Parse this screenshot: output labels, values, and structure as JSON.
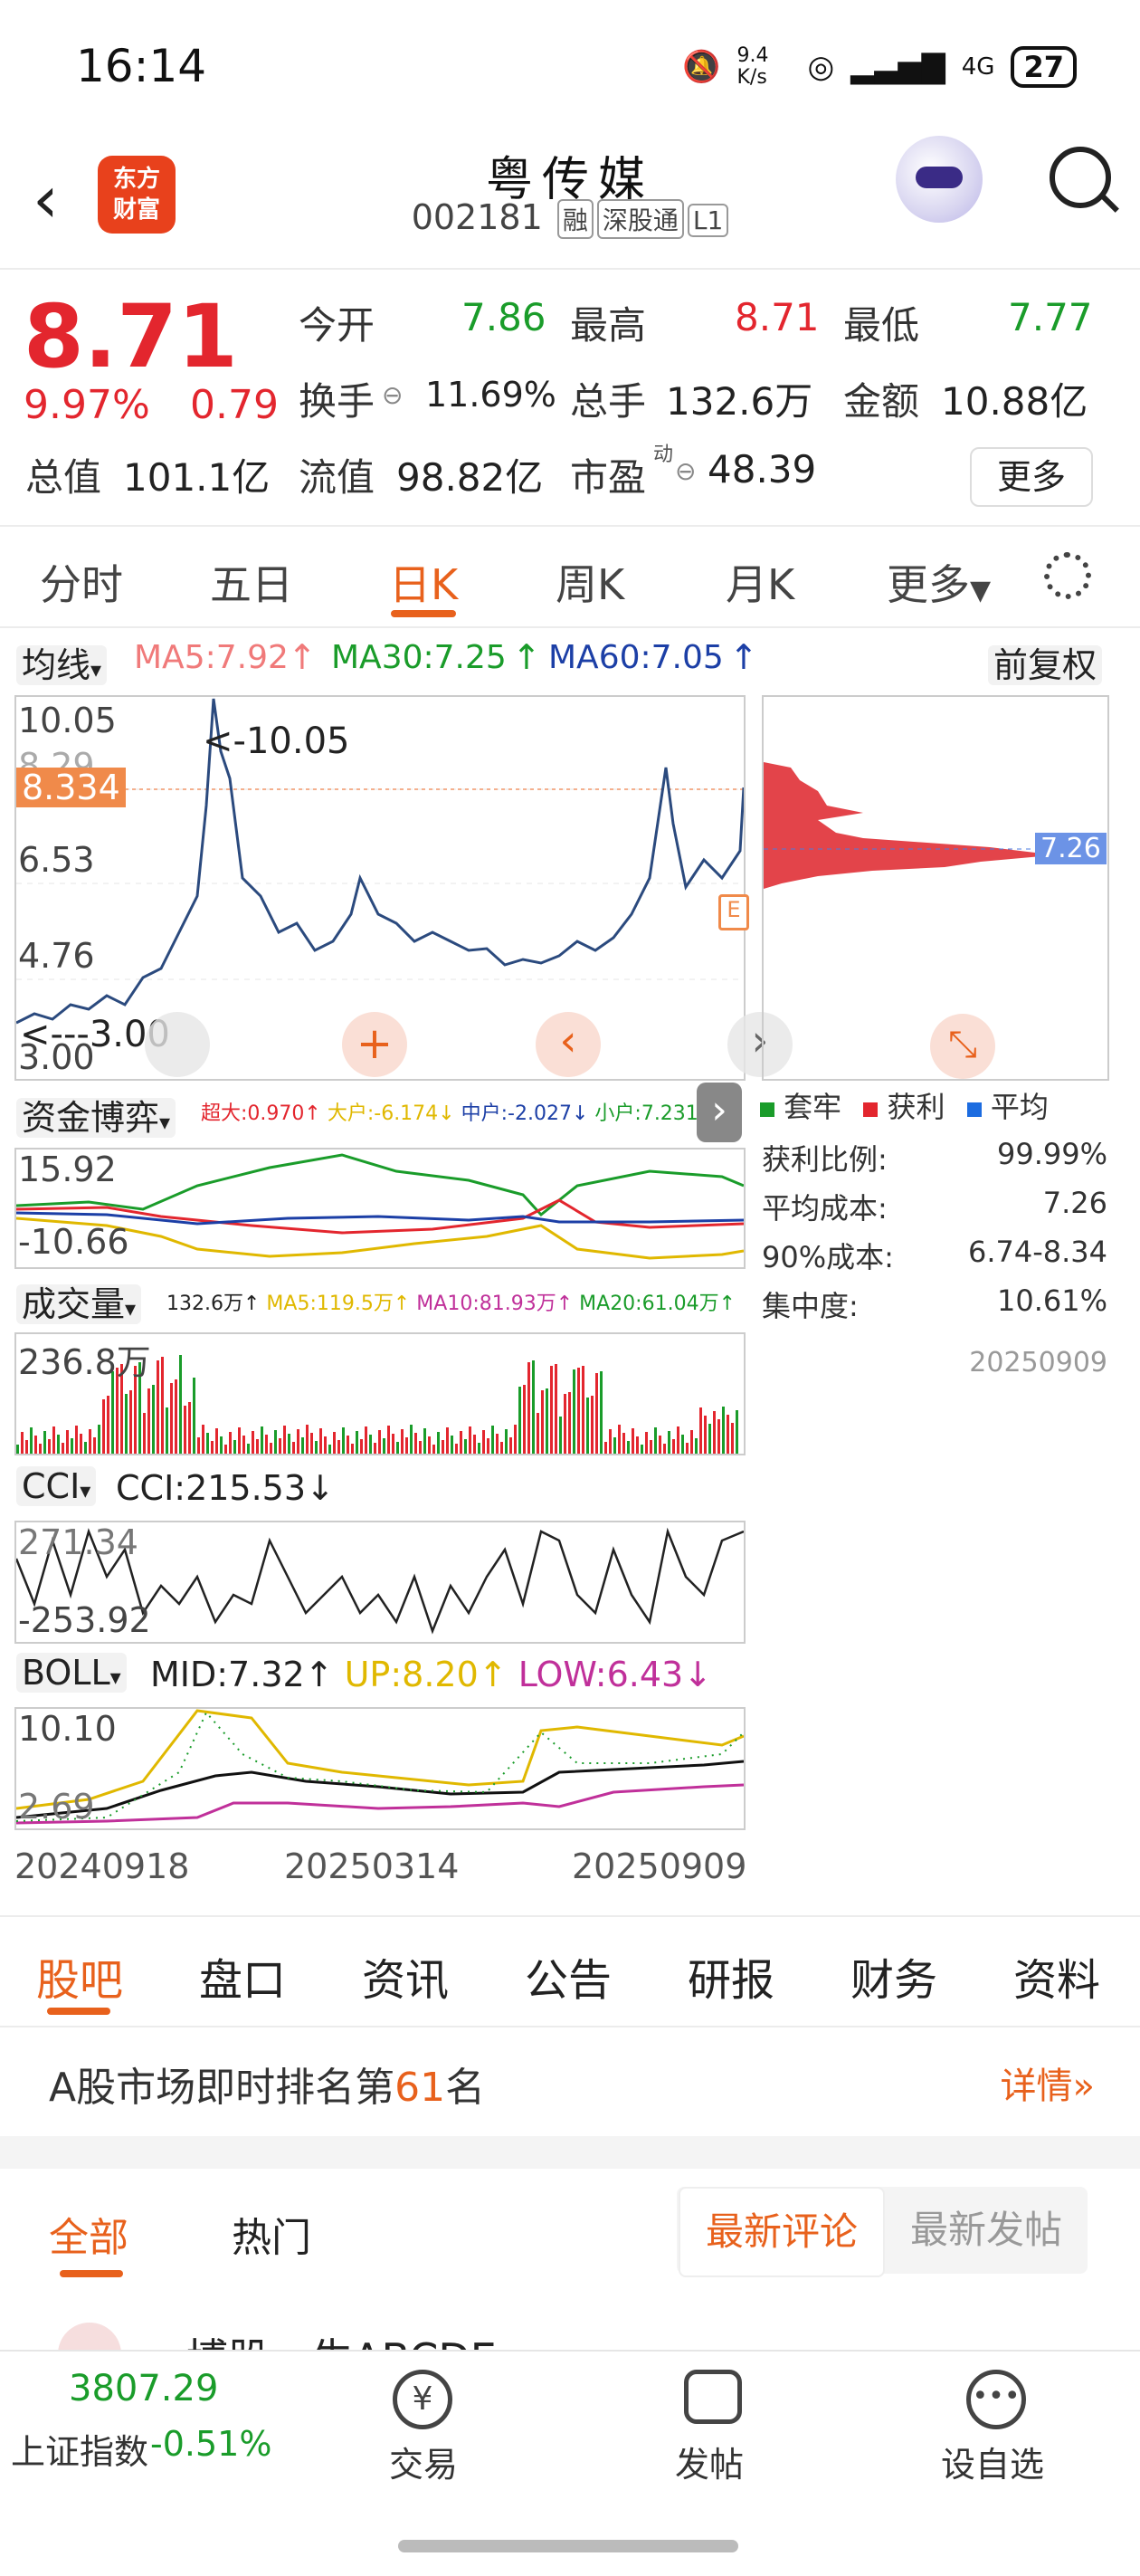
{
  "status_bar": {
    "time": "16:14",
    "net_speed": "9.4 K/s",
    "signal": "4G",
    "battery": "27"
  },
  "header": {
    "logo_line1": "东方",
    "logo_line2": "财富",
    "name": "粤传媒",
    "code": "002181",
    "tags": [
      "融",
      "深股通",
      "L1"
    ]
  },
  "quote": {
    "price": "8.71",
    "change_pct": "9.97%",
    "change": "0.79",
    "fields": [
      {
        "label": "今开",
        "value": "7.86",
        "color": "green"
      },
      {
        "label": "最高",
        "value": "8.71",
        "color": "red"
      },
      {
        "label": "最低",
        "value": "7.77",
        "color": "green"
      },
      {
        "label": "换手",
        "value": "11.69%",
        "color": "dark"
      },
      {
        "label": "总手",
        "value": "132.6万",
        "color": "dark"
      },
      {
        "label": "金额",
        "value": "10.88亿",
        "color": "dark"
      },
      {
        "label": "总值",
        "value": "101.1亿",
        "color": "dark"
      },
      {
        "label": "流值",
        "value": "98.82亿",
        "color": "dark"
      },
      {
        "label": "市盈",
        "value": "48.39",
        "color": "dark",
        "sup": "动"
      }
    ],
    "more": "更多"
  },
  "chart_tabs": [
    "分时",
    "五日",
    "日K",
    "周K",
    "月K",
    "更多"
  ],
  "chart_tabs_active": 2,
  "ma": {
    "selector": "均线",
    "ma5": "MA5:7.92",
    "ma30": "MA30:7.25",
    "ma60": "MA60:7.05",
    "adjust": "前复权"
  },
  "kline": {
    "y_top": "10.05",
    "y_mid1": "8.29",
    "y_cur": "8.334",
    "y_mid2": "6.53",
    "y_mid3": "4.76",
    "y_bot": "3.00",
    "hi_label": "<-10.05",
    "lo_label": "<---3.00",
    "hi": 10.05,
    "lo": 3.0
  },
  "chip": {
    "avg_label": "7.26",
    "title_legend": [
      "套牢",
      "获利",
      "平均"
    ],
    "rows": [
      {
        "label": "获利比例:",
        "value": "99.99%"
      },
      {
        "label": "平均成本:",
        "value": "7.26"
      },
      {
        "label": "90%成本:",
        "value": "6.74-8.34"
      },
      {
        "label": "集中度:",
        "value": "10.61%"
      }
    ],
    "date": "20250909"
  },
  "fund": {
    "selector": "资金博弈",
    "super": "超大:0.970",
    "big": "大户:-6.174",
    "mid": "中户:-2.027",
    "small": "小户:7.231",
    "y_top": "15.92",
    "y_bot": "-10.66"
  },
  "volume": {
    "selector": "成交量",
    "vol": "132.6万",
    "ma5": "MA5:119.5万",
    "ma10": "MA10:81.93万",
    "ma20": "MA20:61.04万",
    "y_top": "236.8万"
  },
  "cci": {
    "selector": "CCI",
    "value": "CCI:215.53",
    "y_top": "271.34",
    "y_bot": "-253.92"
  },
  "boll": {
    "selector": "BOLL",
    "mid": "MID:7.32",
    "up": "UP:8.20",
    "low": "LOW:6.43",
    "y_top": "10.10",
    "y_bot": "2.69"
  },
  "x_axis": [
    "20240918",
    "20250314",
    "20250909"
  ],
  "bottom_tabs": [
    "股吧",
    "盘口",
    "资讯",
    "公告",
    "研报",
    "财务",
    "资料"
  ],
  "bottom_tabs_active": 0,
  "rank": {
    "prefix": "A股市场即时排名第",
    "num": "61",
    "suffix": "名",
    "detail": "详情"
  },
  "comments": {
    "tab_all": "全部",
    "tab_hot": "热门",
    "seg_new_comment": "最新评论",
    "seg_new_post": "最新发帖",
    "preview": "博股一生ABCDE"
  },
  "bottom_nav": {
    "index_value": "3807.29",
    "index_name": "上证指数",
    "index_change": "-0.51%",
    "items": [
      "交易",
      "发帖",
      "设自选"
    ]
  },
  "colors": {
    "accent": "#e8611c",
    "red": "#e3262e",
    "green": "#1a9c2a",
    "blue": "#1c3fa6",
    "line": "#2b4a7e"
  }
}
